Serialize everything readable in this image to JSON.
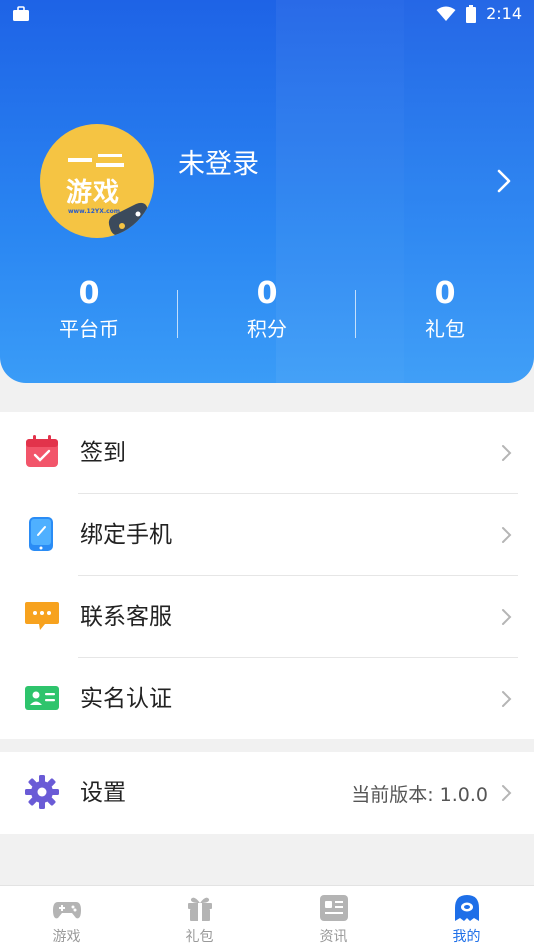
{
  "status_bar": {
    "time": "2:14"
  },
  "profile": {
    "name": "未登录",
    "avatar_logo_text": "游戏",
    "avatar_logo_url": "www.12YX.com"
  },
  "stats": [
    {
      "value": "0",
      "label": "平台币"
    },
    {
      "value": "0",
      "label": "积分"
    },
    {
      "value": "0",
      "label": "礼包"
    }
  ],
  "menu": [
    {
      "label": "签到",
      "icon": "calendar-check-icon",
      "color": "#f2556a"
    },
    {
      "label": "绑定手机",
      "icon": "phone-link-icon",
      "color": "#2a8cf5"
    },
    {
      "label": "联系客服",
      "icon": "chat-bubble-icon",
      "color": "#f7a21e"
    },
    {
      "label": "实名认证",
      "icon": "id-card-icon",
      "color": "#2ec46c"
    }
  ],
  "settings": {
    "label": "设置",
    "version_text": "当前版本: 1.0.0",
    "icon": "gear-icon",
    "color": "#6a5bd6"
  },
  "nav": [
    {
      "label": "游戏",
      "icon": "gamepad-icon"
    },
    {
      "label": "礼包",
      "icon": "gift-icon"
    },
    {
      "label": "资讯",
      "icon": "news-icon"
    },
    {
      "label": "我的",
      "icon": "profile-ghost-icon",
      "active": true
    }
  ],
  "colors": {
    "header_top": "#1e63e6",
    "header_bottom": "#3a9cf7",
    "active_tab": "#1e6fe8",
    "avatar_bg": "#f5c443"
  }
}
